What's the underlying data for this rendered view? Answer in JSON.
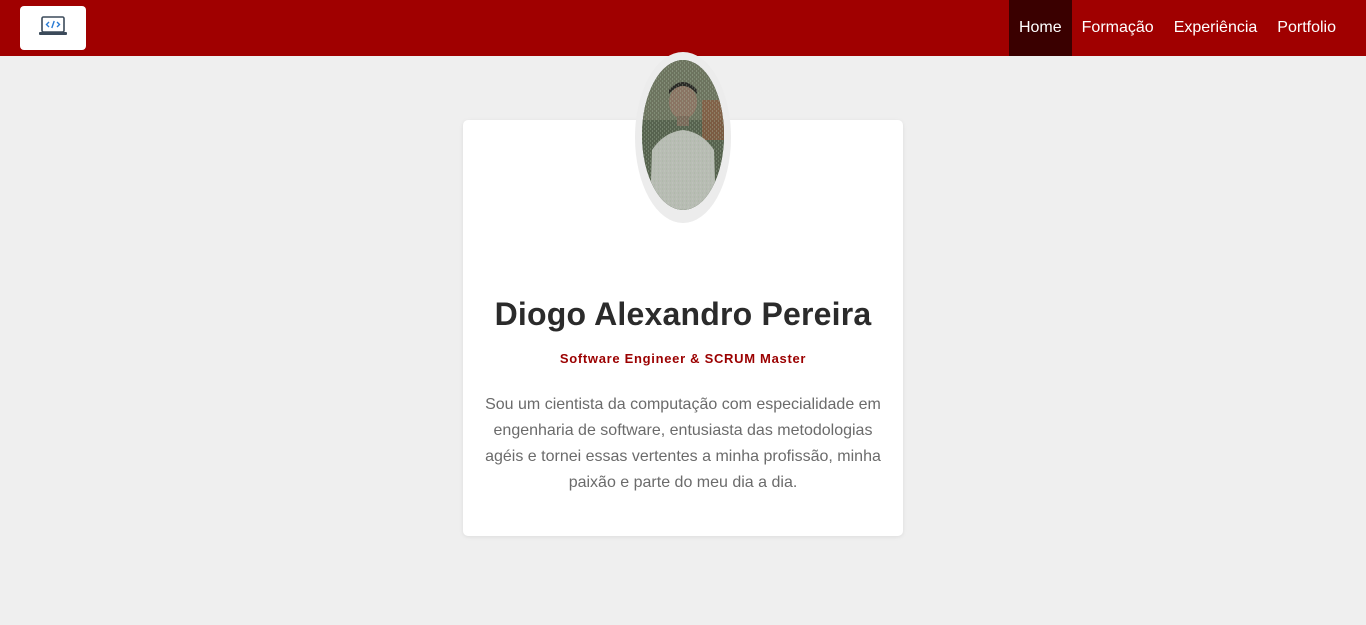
{
  "colors": {
    "navbar": "#a00000",
    "nav_active": "#3a0000",
    "accent": "#9b0000",
    "background": "#efefef",
    "card": "#ffffff"
  },
  "header": {
    "logo_icon": "laptop-code-icon",
    "nav": [
      {
        "label": "Home",
        "active": true
      },
      {
        "label": "Formação",
        "active": false
      },
      {
        "label": "Experiência",
        "active": false
      },
      {
        "label": "Portfolio",
        "active": false
      }
    ]
  },
  "profile": {
    "avatar_icon": "profile-photo",
    "name": "Diogo Alexandro Pereira",
    "role": "Software Engineer & SCRUM Master",
    "bio": "Sou um cientista da computação com especialidade em engenharia de software, entusiasta das metodologias agéis e tornei essas vertentes a minha profissão, minha paixão e parte do meu dia a dia."
  }
}
